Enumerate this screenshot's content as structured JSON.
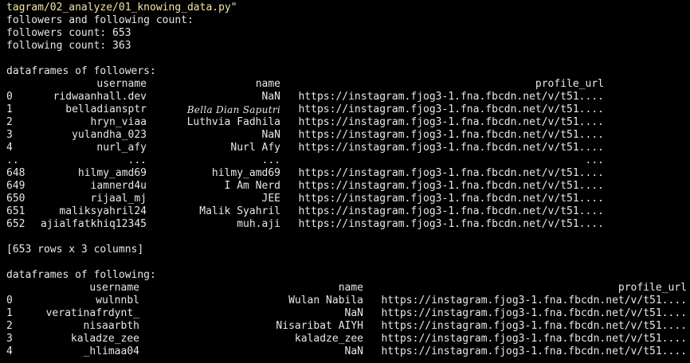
{
  "terminal": {
    "command_line": "tagram/02_analyze/01_knowing_data.py\"",
    "lines": [
      "followers and following count:",
      "followers count: 653",
      "following count: 363"
    ]
  },
  "followers_df": {
    "heading": "dataframes of followers:",
    "columns": [
      "",
      "username",
      "name",
      "profile_url"
    ],
    "rows": [
      [
        "0",
        "ridwaanhall.dev",
        "NaN",
        "https://instagram.fjog3-1.fna.fbcdn.net/v/t51...."
      ],
      [
        "1",
        "belladiansptr",
        "Bella Dian Saputri",
        "https://instagram.fjog3-1.fna.fbcdn.net/v/t51...."
      ],
      [
        "2",
        "hryn_viaa",
        "Luthvia Fadhila",
        "https://instagram.fjog3-1.fna.fbcdn.net/v/t51...."
      ],
      [
        "3",
        "yulandha_023",
        "NaN",
        "https://instagram.fjog3-1.fna.fbcdn.net/v/t51...."
      ],
      [
        "4",
        "nurl_afy",
        "Nurl Afy",
        "https://instagram.fjog3-1.fna.fbcdn.net/v/t51...."
      ],
      [
        "..",
        "...",
        "...",
        "..."
      ],
      [
        "648",
        "hilmy_amd69",
        "hilmy_amd69",
        "https://instagram.fjog3-1.fna.fbcdn.net/v/t51...."
      ],
      [
        "649",
        "iamnerd4u",
        "I Am Nerd",
        "https://instagram.fjog3-1.fna.fbcdn.net/v/t51...."
      ],
      [
        "650",
        "rijaal_mj",
        "JEE",
        "https://instagram.fjog3-1.fna.fbcdn.net/v/t51...."
      ],
      [
        "651",
        "maliksyahril24",
        "Malik Syahril",
        "https://instagram.fjog3-1.fna.fbcdn.net/v/t51...."
      ],
      [
        "652",
        "ajialfatkhiq12345",
        "muh.aji",
        "https://instagram.fjog3-1.fna.fbcdn.net/v/t51...."
      ]
    ],
    "shape_summary": "[653 rows x 3 columns]"
  },
  "following_df": {
    "heading": "dataframes of following:",
    "columns": [
      "",
      "username",
      "name",
      "profile_url"
    ],
    "rows": [
      [
        "0",
        "wulnnbl",
        "Wulan Nabila",
        "https://instagram.fjog3-1.fna.fbcdn.net/v/t51...."
      ],
      [
        "1",
        "veratinafrdynt_",
        "NaN",
        "https://instagram.fjog3-1.fna.fbcdn.net/v/t51...."
      ],
      [
        "2",
        "nisaarbth",
        "Nisaribat AIYH",
        "https://instagram.fjog3-1.fna.fbcdn.net/v/t51...."
      ],
      [
        "3",
        "kaladze_zee",
        "kaladze_zee",
        "https://instagram.fjog3-1.fna.fbcdn.net/v/t51...."
      ],
      [
        "4",
        "_hlimaa04",
        "NaN",
        "https://instagram.fjog3-1.fna.fbcdn.net/v/t51...."
      ]
    ]
  },
  "colors": {
    "background": "#000000",
    "text": "#e8e8e8",
    "command": "#f2e6a4"
  }
}
